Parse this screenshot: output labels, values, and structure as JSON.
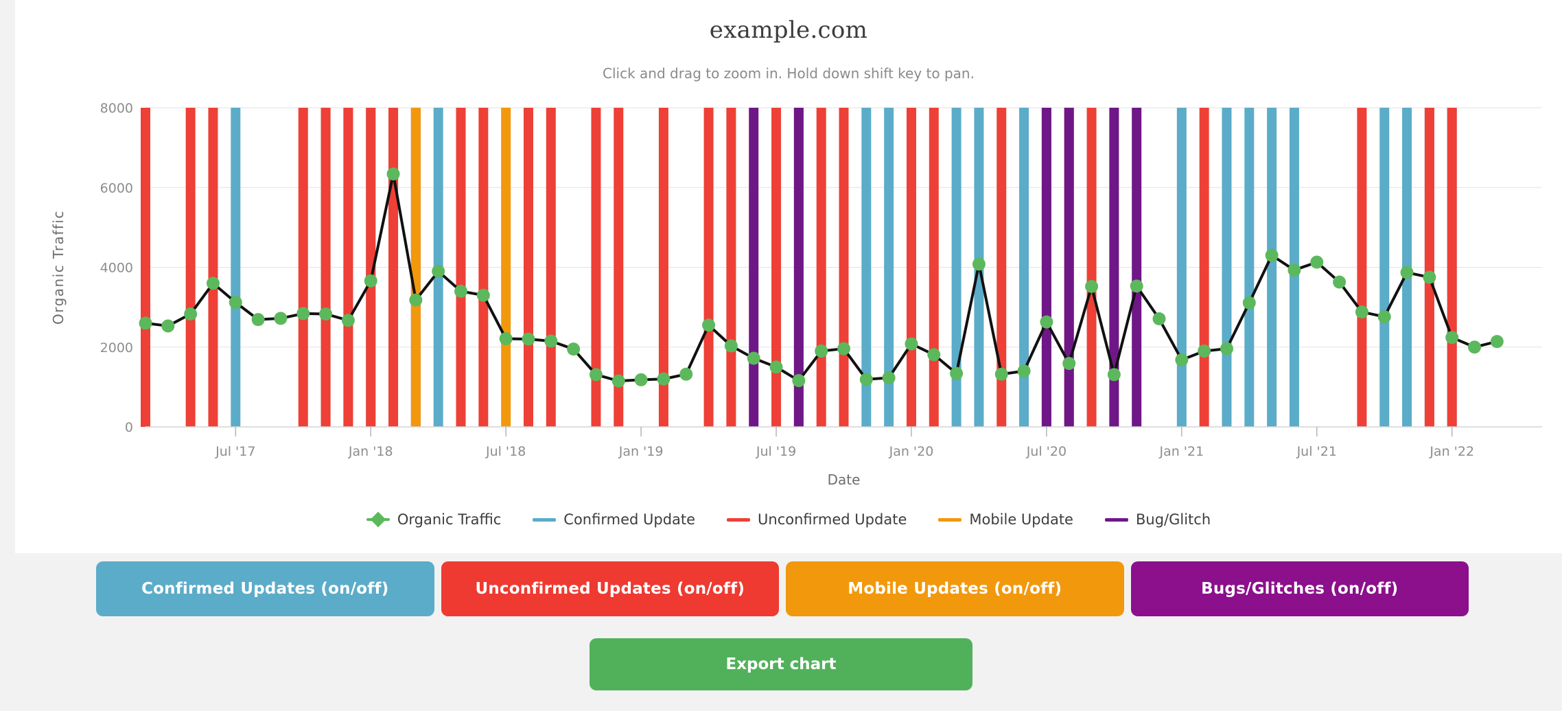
{
  "chart_card": {
    "title": "example.com",
    "subtitle": "Click and drag to zoom in. Hold down shift key to pan."
  },
  "legend": [
    {
      "label": "Organic Traffic",
      "color": "#5cb85c",
      "style": "marker"
    },
    {
      "label": "Confirmed Update",
      "color": "#5bacc8",
      "style": "line"
    },
    {
      "label": "Unconfirmed Update",
      "color": "#ee4036",
      "style": "line"
    },
    {
      "label": "Mobile Update",
      "color": "#f2980c",
      "style": "line"
    },
    {
      "label": "Bug/Glitch",
      "color": "#6f1787",
      "style": "line"
    }
  ],
  "toggle_buttons": [
    {
      "label": "Confirmed Updates (on/off)",
      "color": "#5bacc8"
    },
    {
      "label": "Unconfirmed Updates (on/off)",
      "color": "#ee3a31"
    },
    {
      "label": "Mobile Updates (on/off)",
      "color": "#f2980c"
    },
    {
      "label": "Bugs/Glitches (on/off)",
      "color": "#8c0f8c"
    }
  ],
  "export_button": {
    "label": "Export chart",
    "color": "#51b15b"
  },
  "chart_data": {
    "type": "line",
    "title": "example.com",
    "subtitle": "Click and drag to zoom in. Hold down shift key to pan.",
    "xlabel": "Date",
    "ylabel": "Organic Traffic",
    "ylim": [
      0,
      8000
    ],
    "yticks": [
      0,
      2000,
      4000,
      6000,
      8000
    ],
    "xlim": [
      "2017-03",
      "2022-05"
    ],
    "xticks": [
      "Jul '17",
      "Jan '18",
      "Jul '18",
      "Jan '19",
      "Jul '19",
      "Jan '20",
      "Jul '20",
      "Jan '21",
      "Jul '21",
      "Jan '22"
    ],
    "grid": true,
    "legend_position": "bottom",
    "marker": "diamond",
    "line_color": "#111111",
    "marker_color": "#5cb85c",
    "series": [
      {
        "name": "Organic Traffic",
        "x": [
          "2017-03",
          "2017-04",
          "2017-05",
          "2017-06",
          "2017-07",
          "2017-08",
          "2017-09",
          "2017-10",
          "2017-11",
          "2017-12",
          "2018-01",
          "2018-02",
          "2018-03",
          "2018-04",
          "2018-05",
          "2018-06",
          "2018-07",
          "2018-08",
          "2018-09",
          "2018-10",
          "2018-11",
          "2018-12",
          "2019-01",
          "2019-02",
          "2019-03",
          "2019-04",
          "2019-05",
          "2019-06",
          "2019-07",
          "2019-08",
          "2019-09",
          "2019-10",
          "2019-11",
          "2019-12",
          "2020-01",
          "2020-02",
          "2020-03",
          "2020-04",
          "2020-05",
          "2020-06",
          "2020-07",
          "2020-08",
          "2020-09",
          "2020-10",
          "2020-11",
          "2020-12",
          "2021-01",
          "2021-02",
          "2021-03",
          "2021-04",
          "2021-05",
          "2021-06",
          "2021-07",
          "2021-08",
          "2021-09",
          "2021-10",
          "2021-11",
          "2021-12",
          "2022-01",
          "2022-02",
          "2022-03"
        ],
        "values": [
          2600,
          2530,
          2830,
          3600,
          3120,
          2690,
          2720,
          2840,
          2830,
          2670,
          3660,
          6340,
          3180,
          3900,
          3400,
          3300,
          2210,
          2200,
          2150,
          1950,
          1310,
          1150,
          1180,
          1200,
          1320,
          2550,
          2030,
          1720,
          1500,
          1160,
          1900,
          1960,
          1190,
          1230,
          2080,
          1810,
          1340,
          4080,
          1320,
          1400,
          2630,
          1590,
          3520,
          1310,
          3530,
          2710,
          1680,
          1900,
          1960,
          3110,
          4300,
          3930,
          4130,
          3630,
          2880,
          2760,
          3870,
          3750,
          2240,
          2000,
          2140
        ]
      }
    ],
    "event_bands": {
      "Confirmed Update": {
        "color": "#5bacc8",
        "dates": [
          "2017-07",
          "2017-11",
          "2017-12",
          "2018-01",
          "2018-02",
          "2018-03",
          "2018-04",
          "2018-05",
          "2019-08",
          "2019-11",
          "2019-12",
          "2020-03",
          "2020-04",
          "2020-06",
          "2020-07",
          "2021-01",
          "2021-03",
          "2021-04",
          "2021-05",
          "2021-06",
          "2021-10",
          "2021-11",
          "2021-12",
          "2022-01"
        ]
      },
      "Unconfirmed Update": {
        "color": "#ee4036",
        "dates": [
          "2017-03",
          "2017-05",
          "2017-06",
          "2017-10",
          "2017-11",
          "2017-12",
          "2018-01",
          "2018-02",
          "2018-03",
          "2018-05",
          "2018-06",
          "2018-08",
          "2018-09",
          "2018-11",
          "2018-12",
          "2019-02",
          "2019-04",
          "2019-05",
          "2019-07",
          "2019-09",
          "2019-10",
          "2020-01",
          "2020-02",
          "2020-05",
          "2020-08",
          "2020-09",
          "2021-02",
          "2021-09",
          "2021-12",
          "2022-01"
        ]
      },
      "Mobile Update": {
        "color": "#f2980c",
        "dates": [
          "2018-03",
          "2018-07"
        ]
      },
      "Bug/Glitch": {
        "color": "#6f1787",
        "dates": [
          "2019-06",
          "2019-08",
          "2020-07",
          "2020-08",
          "2020-10",
          "2020-11"
        ]
      }
    }
  }
}
